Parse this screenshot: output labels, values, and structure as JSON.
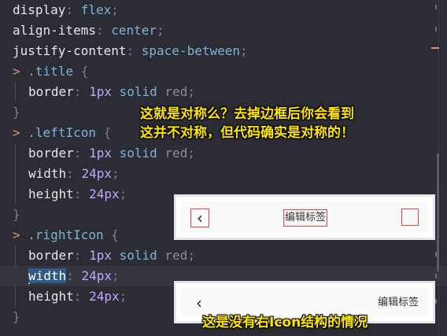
{
  "code": {
    "l1": {
      "prop": "display",
      "value": "flex"
    },
    "l2": {
      "prop": "align-items",
      "value": "center"
    },
    "l3": {
      "prop": "justify-content",
      "value": "space-between"
    },
    "title_selector": ".title",
    "title_border": {
      "prop": "border",
      "num": "1px",
      "style": "solid",
      "color": "red"
    },
    "left_selector": ".leftIcon",
    "left_border": {
      "prop": "border",
      "num": "1px",
      "style": "solid",
      "color": "red"
    },
    "left_width": {
      "prop": "width",
      "num": "24px"
    },
    "left_height": {
      "prop": "height",
      "num": "24px"
    },
    "right_selector": ".rightIcon",
    "right_border": {
      "prop": "border",
      "num": "1px",
      "style": "solid",
      "color": "red"
    },
    "right_width": {
      "prop": "width",
      "num": "24px"
    },
    "right_height": {
      "prop": "height",
      "num": "24px"
    },
    "arrow": ">",
    "open_brace": "{",
    "close_brace": "}"
  },
  "captions": {
    "line1": "这就是对称么？去掉边框后你会看到",
    "line2": "这并不对称，但代码确实是对称的！",
    "line3": "这是没有右Icon结构的情况"
  },
  "preview1": {
    "back_icon": "‹",
    "title": "编辑标签"
  },
  "preview2": {
    "back_icon": "‹",
    "title": "编辑标签"
  }
}
